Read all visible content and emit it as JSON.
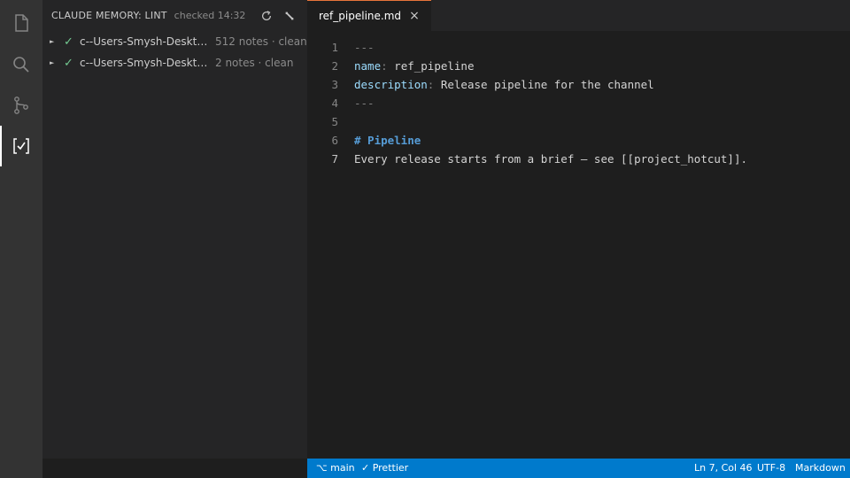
{
  "activity_bar": {
    "items": [
      {
        "icon": "files-icon",
        "active": false
      },
      {
        "icon": "search-icon",
        "active": false
      },
      {
        "icon": "source-control-icon",
        "active": false
      },
      {
        "icon": "memory-lint-icon",
        "active": true
      }
    ]
  },
  "sidebar": {
    "title": "CLAUDE MEMORY: LINT",
    "subtitle": "checked 14:32",
    "actions": {
      "refresh_icon": "refresh-icon",
      "wrench_icon": "wrench-icon"
    },
    "items": [
      {
        "label": "c--Users-Smysh-Desktop-...",
        "status_icon": "✓",
        "description": "512 notes · clean"
      },
      {
        "label": "c--Users-Smysh-Desktop-...",
        "status_icon": "✓",
        "description": "2 notes · clean"
      }
    ]
  },
  "editor": {
    "tab": {
      "label": "ref_pipeline.md",
      "close": "×"
    },
    "lines": [
      {
        "n": "1",
        "text": "---"
      },
      {
        "n": "2",
        "key": "name",
        "sep": ": ",
        "value": "ref_pipeline"
      },
      {
        "n": "3",
        "key": "description",
        "sep": ": ",
        "value": "Release pipeline for the channel"
      },
      {
        "n": "4",
        "text": "---"
      },
      {
        "n": "5",
        "text": ""
      },
      {
        "n": "6",
        "heading": "# Pipeline"
      },
      {
        "n": "7",
        "text": "Every release starts from a brief — see [[project_hotcut]]."
      }
    ]
  },
  "status_bar": {
    "branch": "⌥ main",
    "prettier": "✓ Prettier",
    "position": "Ln 7, Col 46",
    "encoding": "UTF-8",
    "language": "Markdown"
  },
  "colors": {
    "accent": "#007acc",
    "tab_border": "#e8743b",
    "check": "#73c991"
  }
}
